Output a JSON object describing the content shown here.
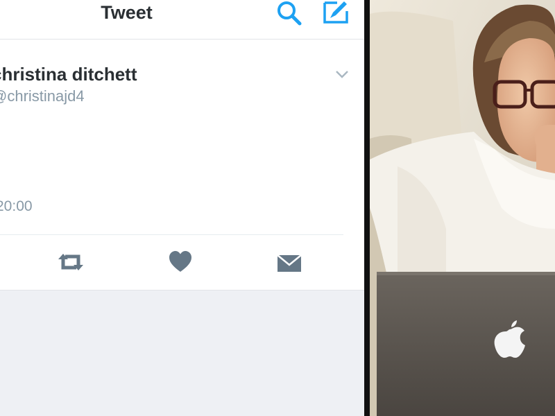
{
  "header": {
    "title": "Tweet",
    "search_icon": "search-icon",
    "compose_icon": "compose-icon"
  },
  "tweet": {
    "author_name": "christina ditchett",
    "author_handle": "@christinajd4",
    "timestamp": "20:00",
    "menu_icon": "chevron-down-icon"
  },
  "actions": [
    {
      "name": "retweet",
      "icon": "retweet-icon"
    },
    {
      "name": "like",
      "icon": "heart-icon"
    },
    {
      "name": "direct-message",
      "icon": "envelope-icon"
    }
  ],
  "colors": {
    "accent": "#1da1f2",
    "text_primary": "#2a2f33",
    "text_secondary": "#8899a6",
    "action_icon": "#657786"
  },
  "photo": {
    "subject": "woman with glasses in white robe looking at laptop",
    "laptop_logo": "apple-logo"
  }
}
